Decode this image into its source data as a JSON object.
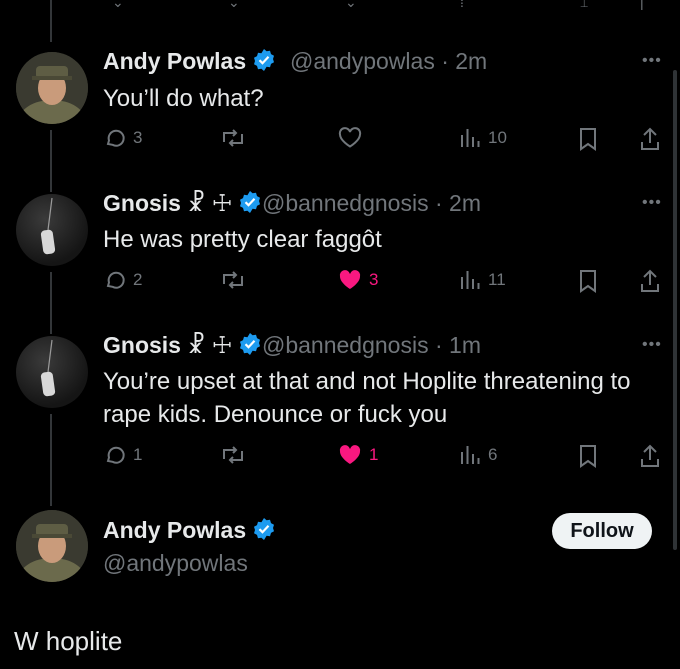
{
  "posts": [
    {
      "name": "Andy Powlas",
      "handle": "@andypowlas",
      "time": "· 2m",
      "text": "You’ll do what?",
      "replies": "3",
      "reposts": "",
      "likes": "",
      "views": "10"
    },
    {
      "name": "Gnosis ☧ ☩",
      "handle": "@bannedgnosis",
      "time": "· 2m",
      "text": "He was pretty clear faggôt",
      "replies": "2",
      "reposts": "",
      "likes": "3",
      "views": "11"
    },
    {
      "name": "Gnosis ☧ ☩",
      "handle": "@bannedgnosis",
      "time": "· 1m",
      "text": "You’re upset at that and not Hoplite threatening to rape kids. Denounce or fuck you",
      "replies": "1",
      "reposts": "",
      "likes": "1",
      "views": "6"
    }
  ],
  "profile_card": {
    "name": "Andy Powlas",
    "handle": "@andypowlas",
    "follow_label": "Follow"
  },
  "reply_text": "W hoplite",
  "colors": {
    "background": "#000000",
    "text": "#e7e9ea",
    "muted": "#71767b",
    "verified": "#1d9bf0",
    "like": "#f91880"
  }
}
